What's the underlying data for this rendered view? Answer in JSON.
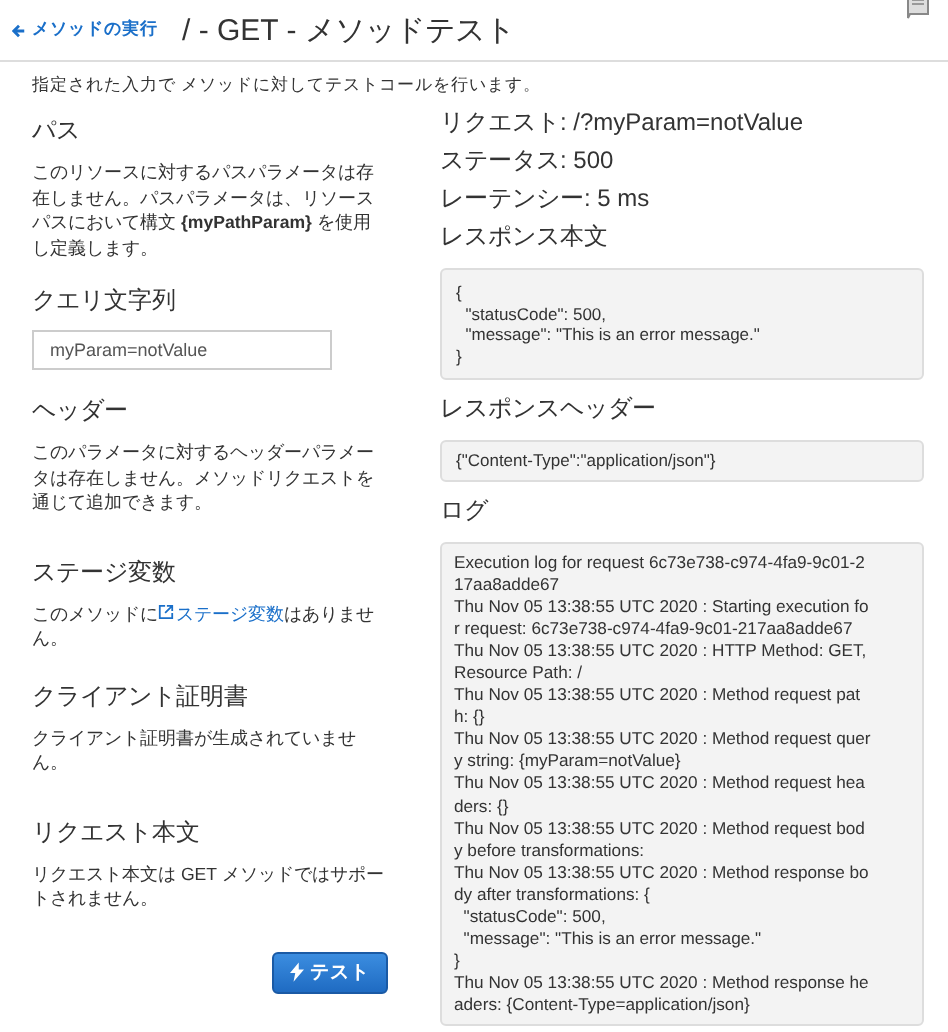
{
  "header": {
    "back_link": "メソッドの実行",
    "title": "/ - GET - メソッドテスト"
  },
  "intro": "指定された入力で メソッドに対してテストコールを行います。",
  "left_sections": [
    {
      "kind": "text",
      "title": "パス",
      "text": "このリソースに対するパスパラメータは存在しません。パスパラメータは、リソースパスにおいて構文 **{myPathParam}** を使用し定義します。"
    },
    {
      "kind": "input",
      "title": "クエリ文字列",
      "value": "myParam=notValue"
    },
    {
      "kind": "text",
      "title": "ヘッダー",
      "text": "このパラメータに対するヘッダーパラメータは存在しません。メソッドリクエストを通じて追加できます。"
    },
    {
      "kind": "link",
      "title": "ステージ変数",
      "before": "このメソッドに",
      "link": "ステージ変数",
      "after": "はありません。"
    },
    {
      "kind": "text",
      "title": "クライアント証明書",
      "text": "クライアント証明書が生成されていません。"
    },
    {
      "kind": "text",
      "title": "リクエスト本文",
      "text": "リクエスト本文は GET メソッドではサポートされません。"
    }
  ],
  "test_button": "テスト",
  "result": {
    "request": "リクエスト: /?myParam=notValue",
    "status": "ステータス: 500",
    "latency": "レーテンシー: 5 ms",
    "body_title": "レスポンス本文",
    "body_lines": [
      "{",
      "  \"statusCode\": 500,",
      "  \"message\": \"This is an error message.\"",
      "}"
    ],
    "headers_title": "レスポンスヘッダー",
    "headers": "{\"Content-Type\":\"application/json\"}",
    "log_title": "ログ",
    "log_lines": [
      "Execution log for request 6c73e738-c974-4fa9-9c01-2",
      "17aa8adde67",
      "Thu Nov 05 13:38:55 UTC 2020 : Starting execution fo",
      "r request: 6c73e738-c974-4fa9-9c01-217aa8adde67",
      "Thu Nov 05 13:38:55 UTC 2020 : HTTP Method: GET,",
      "Resource Path: /",
      "Thu Nov 05 13:38:55 UTC 2020 : Method request pat",
      "h: {}",
      "Thu Nov 05 13:38:55 UTC 2020 : Method request quer",
      "y string: {myParam=notValue}",
      "Thu Nov 05 13:38:55 UTC 2020 : Method request hea",
      "ders: {}",
      "Thu Nov 05 13:38:55 UTC 2020 : Method request bod",
      "y before transformations:",
      "Thu Nov 05 13:38:55 UTC 2020 : Method response bo",
      "dy after transformations: {",
      "  \"statusCode\": 500,",
      "  \"message\": \"This is an error message.\"",
      "}",
      "Thu Nov 05 13:38:55 UTC 2020 : Method response he",
      "aders: {Content-Type=application/json}"
    ]
  }
}
